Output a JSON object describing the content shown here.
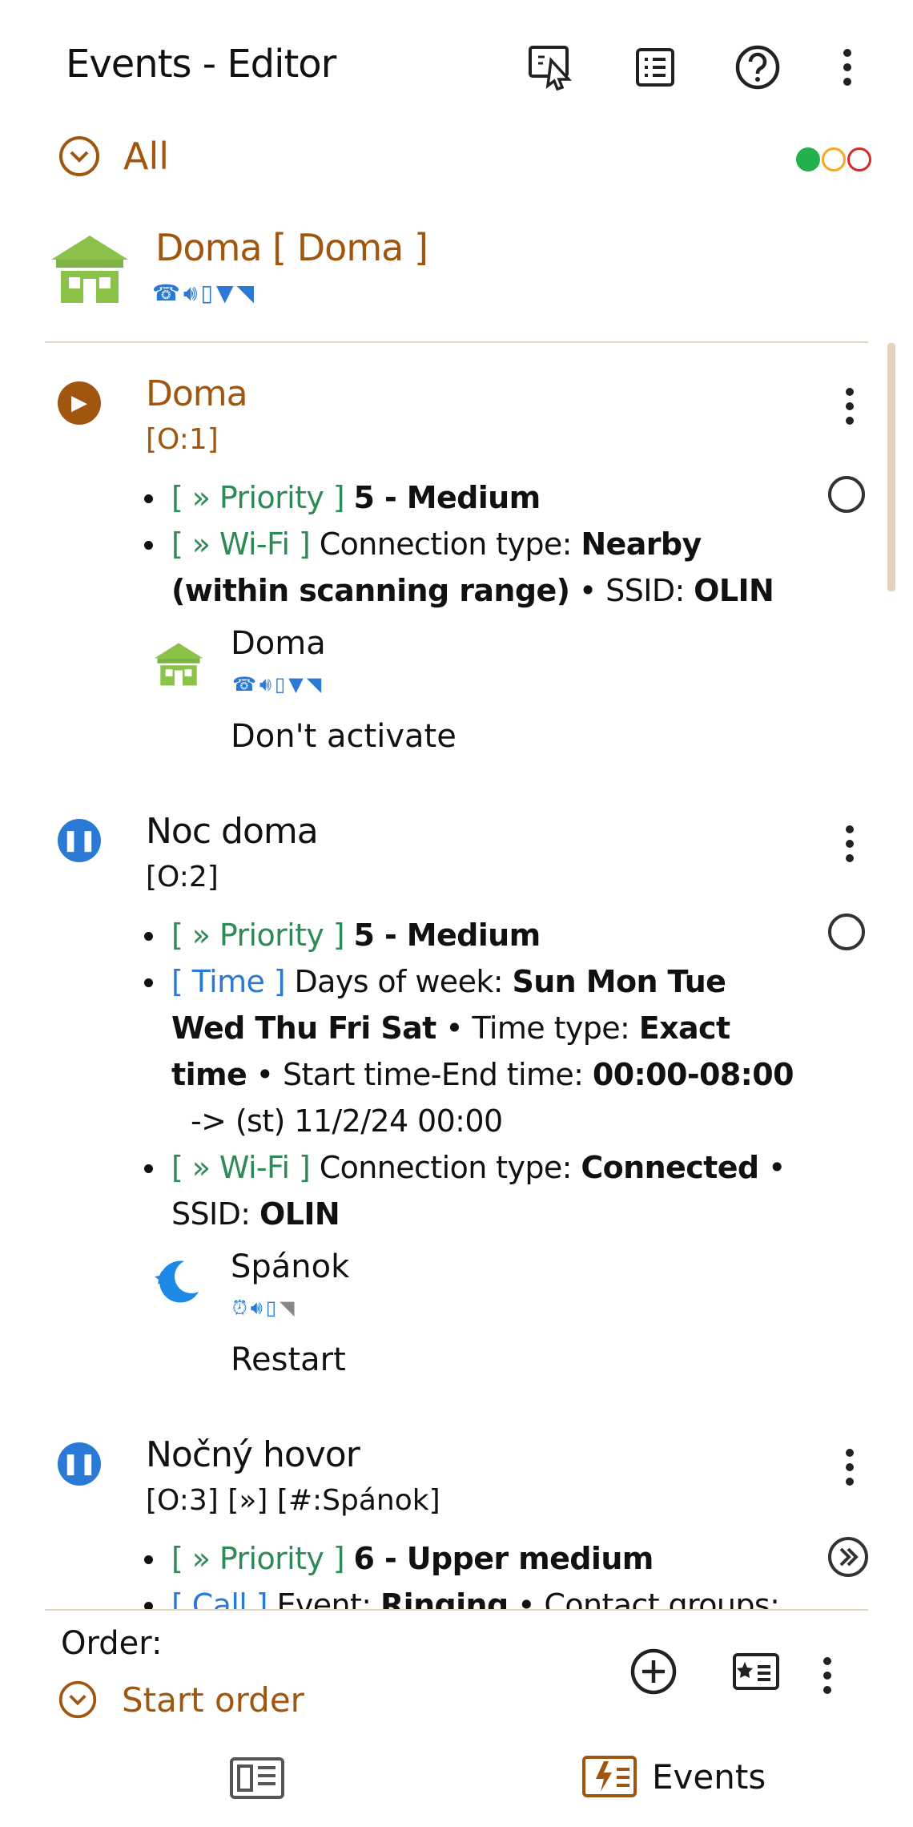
{
  "toolbar": {
    "title": "Events - Editor",
    "icons": [
      "run-event-icon",
      "list-icon",
      "help-icon",
      "more-icon"
    ]
  },
  "filter": {
    "label": "All",
    "status_dot_colors": [
      "#22b14c",
      "#f5a623",
      "#d62828"
    ]
  },
  "active_profile": {
    "name": "Doma [ Doma ]",
    "icon": "house-icon",
    "indicator_icons": [
      "ringer-icon",
      "volume-icon",
      "vibrate-icon",
      "wifi-icon",
      "wifi-ap-icon"
    ]
  },
  "events": [
    {
      "name": "Doma",
      "order": "[O:1]",
      "status": "running",
      "name_color": "#a0560f",
      "conditions": [
        {
          "tag": "[ » Priority ]",
          "parts": [
            {
              "t": "5 - Medium",
              "b": true
            }
          ]
        },
        {
          "tag": "[ » Wi-Fi ]",
          "parts": [
            {
              "t": "Connection type: ",
              "b": false
            },
            {
              "t": "Nearby (within scanning range)",
              "b": true
            },
            {
              "t": " • SSID: ",
              "b": false
            },
            {
              "t": "OLIN",
              "b": true
            }
          ]
        }
      ],
      "profile": {
        "name": "Doma",
        "icon": "house-icon"
      },
      "end_action": "Don't activate"
    },
    {
      "name": "Noc doma",
      "order": "[O:2]",
      "status": "paused",
      "conditions": [
        {
          "tag": "[ » Priority ]",
          "parts": [
            {
              "t": "5 - Medium",
              "b": true
            }
          ]
        },
        {
          "tag": "[ Time ]",
          "parts": [
            {
              "t": "Days of week: ",
              "b": false
            },
            {
              "t": "Sun Mon Tue Wed Thu Fri Sat",
              "b": true
            },
            {
              "t": " • Time type: ",
              "b": false
            },
            {
              "t": "Exact time",
              "b": true
            },
            {
              "t": " • Start time-End time: ",
              "b": false
            },
            {
              "t": "00:00-08:00",
              "b": true
            }
          ],
          "extra": "-> (st) 11/2/24 00:00"
        },
        {
          "tag": "[ » Wi-Fi ]",
          "parts": [
            {
              "t": "Connection type: ",
              "b": false
            },
            {
              "t": "Connected",
              "b": true
            },
            {
              "t": " • SSID: ",
              "b": false
            },
            {
              "t": "OLIN",
              "b": true
            }
          ]
        }
      ],
      "profile": {
        "name": "Spánok",
        "icon": "moon-icon"
      },
      "end_action": "Restart"
    },
    {
      "name": "Nočný hovor",
      "order": "[O:3] [»] [#:Spánok]",
      "status": "paused",
      "conditions": [
        {
          "tag": "[ » Priority ]",
          "parts": [
            {
              "t": "6 - Upper medium",
              "b": true
            }
          ]
        },
        {
          "tag": "[ Call ]",
          "parts": [
            {
              "t": "Event: ",
              "b": false
            },
            {
              "t": "Ringing",
              "b": true
            },
            {
              "t": " • Contact groups:",
              "b": false
            }
          ]
        }
      ]
    }
  ],
  "bottom": {
    "order_label": "Order:",
    "start_order_label": "Start order",
    "nav_profiles_icon": "profiles-icon",
    "nav_events_label": "Events"
  }
}
